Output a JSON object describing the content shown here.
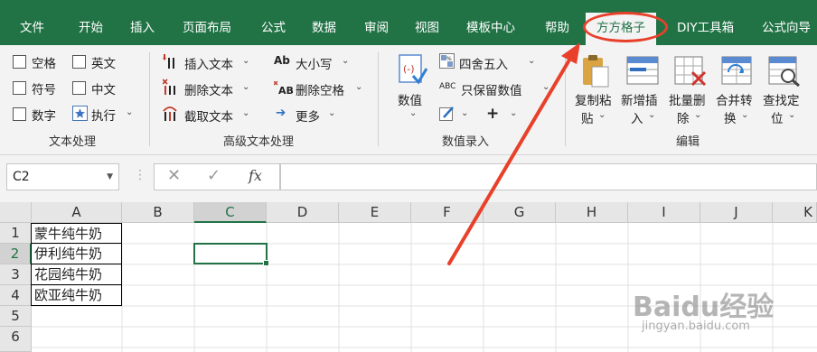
{
  "tabs": [
    {
      "label": "文件"
    },
    {
      "label": "开始"
    },
    {
      "label": "插入"
    },
    {
      "label": "页面布局"
    },
    {
      "label": "公式"
    },
    {
      "label": "数据"
    },
    {
      "label": "审阅"
    },
    {
      "label": "视图"
    },
    {
      "label": "模板中心"
    },
    {
      "label": "帮助"
    },
    {
      "label": "方方格子",
      "active": true
    },
    {
      "label": "DIY工具箱"
    },
    {
      "label": "公式向导"
    }
  ],
  "ribbon": {
    "text_group": {
      "checkboxes": [
        "空格",
        "英文",
        "符号",
        "中文",
        "数字"
      ],
      "execute_label": "执行",
      "label": "文本处理"
    },
    "advanced_group": {
      "items": [
        "插入文本",
        "删除文本",
        "截取文本",
        "大小写",
        "删除空格",
        "更多"
      ],
      "label": "高级文本处理"
    },
    "numeric_group": {
      "value_button": "数值",
      "round_label": "四舍五入",
      "keep_value_label": "只保留数值",
      "plus_label": "+",
      "label": "数值录入"
    },
    "edit_group": {
      "buttons": [
        {
          "line1": "复制粘",
          "line2": "贴"
        },
        {
          "line1": "新增插",
          "line2": "入"
        },
        {
          "line1": "批量删",
          "line2": "除"
        },
        {
          "line1": "合并转",
          "line2": "换"
        },
        {
          "line1": "查找定",
          "line2": "位"
        }
      ],
      "label": "编辑"
    }
  },
  "formula_bar": {
    "name_box": "C2",
    "cancel_glyph": "✕",
    "confirm_glyph": "✓",
    "fx_label": "fx",
    "formula_value": ""
  },
  "sheet": {
    "columns": [
      "A",
      "B",
      "C",
      "D",
      "E",
      "F",
      "G",
      "H",
      "I",
      "J",
      "K"
    ],
    "rows": [
      "1",
      "2",
      "3",
      "4",
      "5",
      "6"
    ],
    "column_a_values": [
      "蒙牛纯牛奶",
      "伊利纯牛奶",
      "花园纯牛奶",
      "欧亚纯牛奶"
    ],
    "active_cell": "C2"
  },
  "watermark": {
    "brand": "Baidu经验",
    "url": "jingyan.baidu.com"
  },
  "colors": {
    "ribbon_green": "#217346",
    "annotation_red": "#e8402a"
  }
}
